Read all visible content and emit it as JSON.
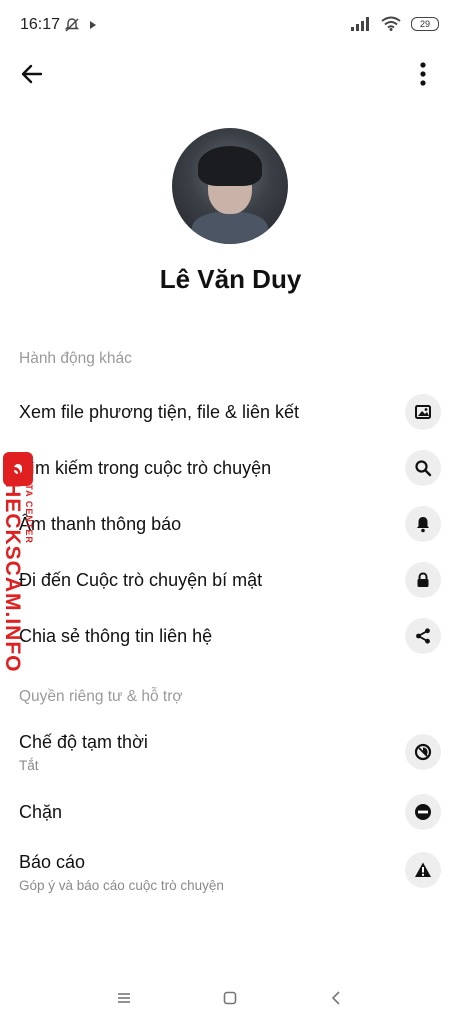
{
  "status_bar": {
    "time": "16:17",
    "battery": "29"
  },
  "profile": {
    "name": "Lê Văn Duy"
  },
  "sections": [
    {
      "header": "Hành động khác"
    },
    {
      "header": "Quyền riêng tư & hỗ trợ"
    }
  ],
  "actions": [
    {
      "label": "Xem file phương tiện, file & liên kết",
      "icon": "image-icon"
    },
    {
      "label": "Tìm kiếm trong cuộc trò chuyện",
      "icon": "search-icon"
    },
    {
      "label": "Âm thanh thông báo",
      "icon": "bell-icon"
    },
    {
      "label": "Đi đến Cuộc trò chuyện bí mật",
      "icon": "lock-icon"
    },
    {
      "label": "Chia sẻ thông tin liên hệ",
      "icon": "share-icon"
    }
  ],
  "privacy": [
    {
      "label": "Chế độ tạm thời",
      "sub": "Tắt",
      "icon": "timer-icon"
    },
    {
      "label": "Chặn",
      "icon": "block-icon"
    },
    {
      "label": "Báo cáo",
      "sub": "Góp ý và báo cáo cuộc trò chuyện",
      "icon": "warning-icon"
    }
  ],
  "watermark": {
    "main": "CHECKSCAM.INFO",
    "sub": "DATA CENTER"
  }
}
